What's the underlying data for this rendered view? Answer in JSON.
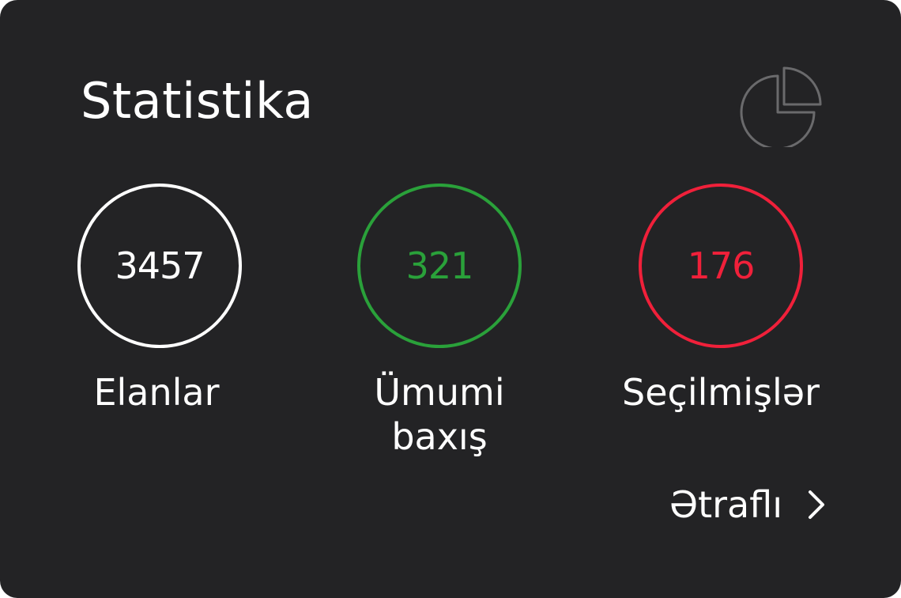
{
  "card": {
    "title": "Statistika",
    "icon": "pie-chart-icon"
  },
  "stats": [
    {
      "value": "3457",
      "label": "Elanlar",
      "color": "#ffffff"
    },
    {
      "value": "321",
      "label": "Ümumi baxış",
      "color": "#2aa13a"
    },
    {
      "value": "176",
      "label": "Seçilmişlər",
      "color": "#f0203a"
    }
  ],
  "more": {
    "label": "Ətraflı",
    "icon": "chevron-right-icon"
  }
}
